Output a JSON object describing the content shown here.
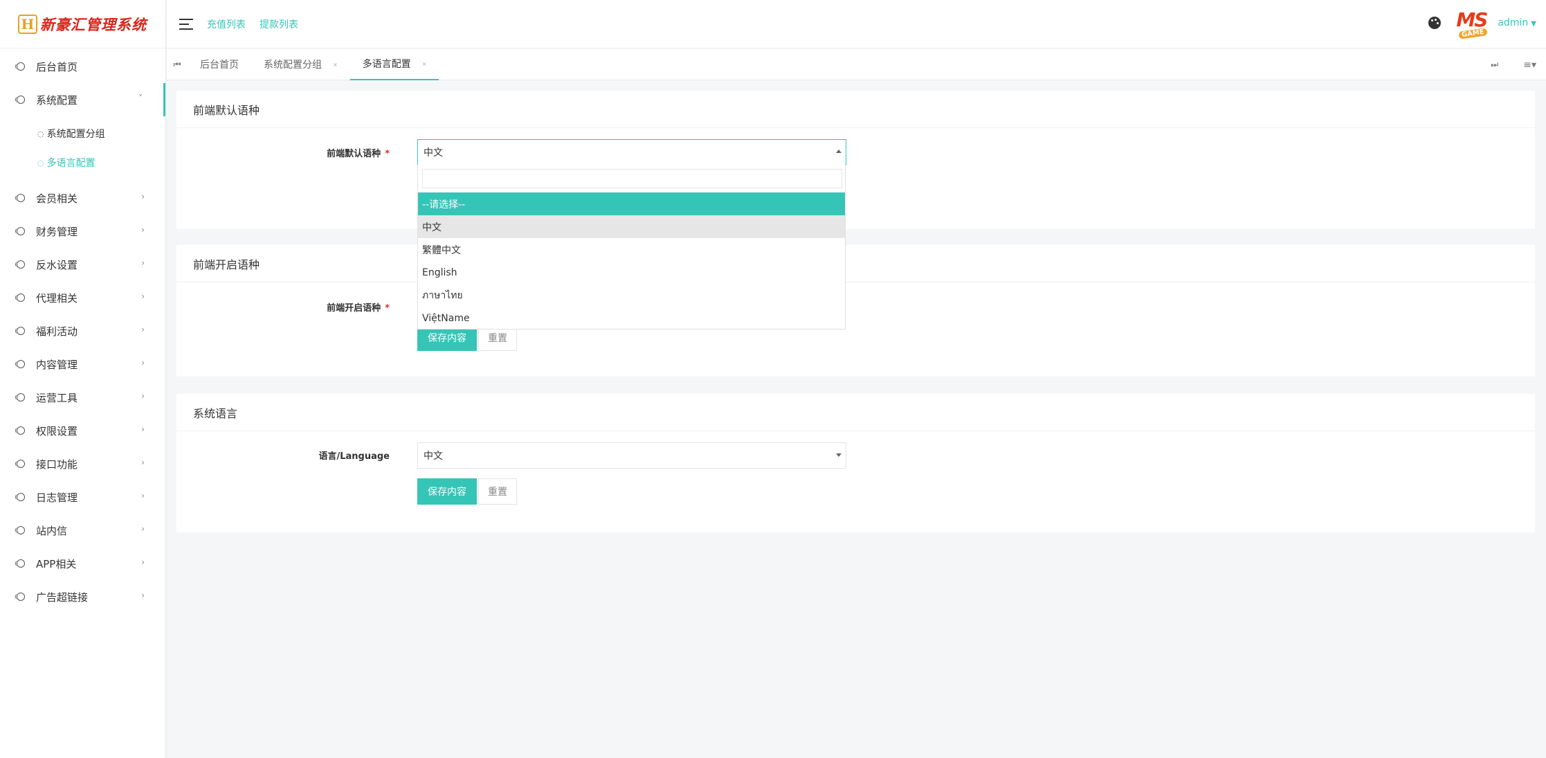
{
  "logo": {
    "mark": "H",
    "text": "新豪汇管理系统"
  },
  "header": {
    "links": [
      "充值列表",
      "提款列表"
    ],
    "avatar_text": "MS",
    "avatar_sub": "GAME",
    "user": "admin"
  },
  "sidebar": {
    "items": [
      {
        "label": "后台首页"
      },
      {
        "label": "系统配置",
        "arrow": "˅"
      },
      {
        "label": "会员相关",
        "arrow": "›"
      },
      {
        "label": "财务管理",
        "arrow": "›"
      },
      {
        "label": "反水设置",
        "arrow": "›"
      },
      {
        "label": "代理相关",
        "arrow": "›"
      },
      {
        "label": "福利活动",
        "arrow": "›"
      },
      {
        "label": "内容管理",
        "arrow": "›"
      },
      {
        "label": "运营工具",
        "arrow": "›"
      },
      {
        "label": "权限设置",
        "arrow": "›"
      },
      {
        "label": "接口功能",
        "arrow": "›"
      },
      {
        "label": "日志管理",
        "arrow": "›"
      },
      {
        "label": "站内信",
        "arrow": "›"
      },
      {
        "label": "APP相关",
        "arrow": "›"
      },
      {
        "label": "广告超链接",
        "arrow": "›"
      }
    ],
    "submenu": [
      {
        "label": "系统配置分组"
      },
      {
        "label": "多语言配置"
      }
    ]
  },
  "tabs": [
    {
      "label": "后台首页"
    },
    {
      "label": "系统配置分组",
      "close": "×"
    },
    {
      "label": "多语言配置",
      "close": "×"
    }
  ],
  "panels": {
    "default_lang": {
      "title": "前端默认语种",
      "label": "前端默认语种",
      "required": "*",
      "value": "中文"
    },
    "enabled_lang": {
      "title": "前端开启语种",
      "label": "前端开启语种",
      "required": "*",
      "save": "保存内容",
      "reset": "重置"
    },
    "system_lang": {
      "title": "系统语言",
      "label": "语言/Language",
      "value": "中文",
      "save": "保存内容",
      "reset": "重置"
    }
  },
  "dropdown": {
    "options": [
      "--请选择--",
      "中文",
      "繁體中文",
      "English",
      "ภาษาไทย",
      "ViệtName"
    ]
  },
  "colors": {
    "accent": "#35c5b6",
    "required": "#e03030",
    "logo": "#d8261c"
  }
}
